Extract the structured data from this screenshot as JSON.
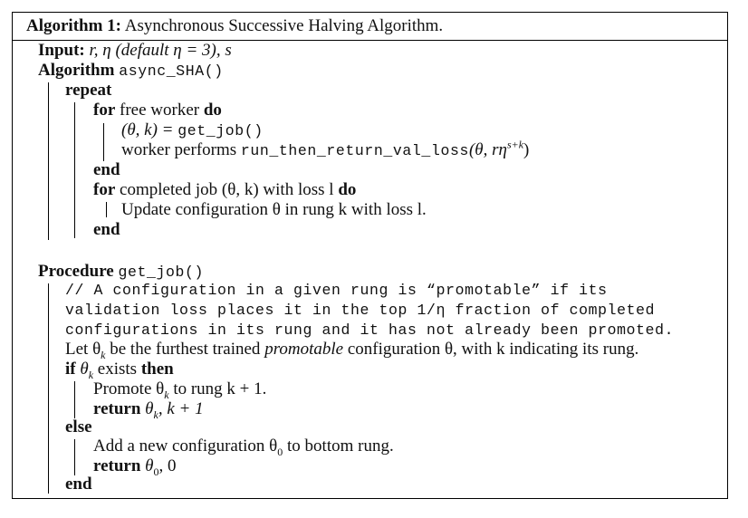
{
  "header": {
    "label": "Algorithm 1:",
    "title": "Asynchronous Successive Halving Algorithm."
  },
  "input": {
    "keyword": "Input:",
    "params": "r, η (default η = 3), s"
  },
  "algorithm": {
    "keyword": "Algorithm",
    "name": "async_SHA()",
    "repeat_kw": "repeat",
    "for1_kw": "for",
    "for1_text": "free worker",
    "do_kw": "do",
    "assign_lhs": "(θ, k) = ",
    "assign_call": "get_job()",
    "worker_text": "worker performs ",
    "worker_call": "run_then_return_val_loss",
    "worker_args": "(θ, rη",
    "worker_sup": "s+k",
    "worker_close": ")",
    "end1_kw": "end",
    "for2_kw": "for",
    "for2_text": "completed job (θ, k) with loss l",
    "do2_kw": "do",
    "update_text": "Update configuration θ in rung k with loss l.",
    "end2_kw": "end"
  },
  "procedure": {
    "keyword": "Procedure",
    "name": "get_job()",
    "comment": [
      "// A configuration in a given rung is “promotable” if its",
      "validation loss places it in the top 1/η fraction of completed",
      "configurations in its rung and it has not already been promoted."
    ],
    "let_a": "Let θ",
    "let_sub": "k",
    "let_b": " be the furthest trained ",
    "let_em": "promotable",
    "let_c": " configuration θ, with k indicating its rung.",
    "if_kw": "if",
    "if_text_a": "θ",
    "if_text_sub": "k",
    "if_text_b": " exists",
    "then_kw": "then",
    "promote_a": "Promote θ",
    "promote_sub": "k",
    "promote_b": " to rung k + 1.",
    "return1_kw": "return",
    "return1_a": "θ",
    "return1_sub": "k",
    "return1_b": ", k + 1",
    "else_kw": "else",
    "add_a": "Add a new configuration θ",
    "add_sub": "0",
    "add_b": " to bottom rung.",
    "return2_kw": "return",
    "return2_a": "θ",
    "return2_sub": "0",
    "return2_b": ", 0",
    "end_kw": "end"
  }
}
